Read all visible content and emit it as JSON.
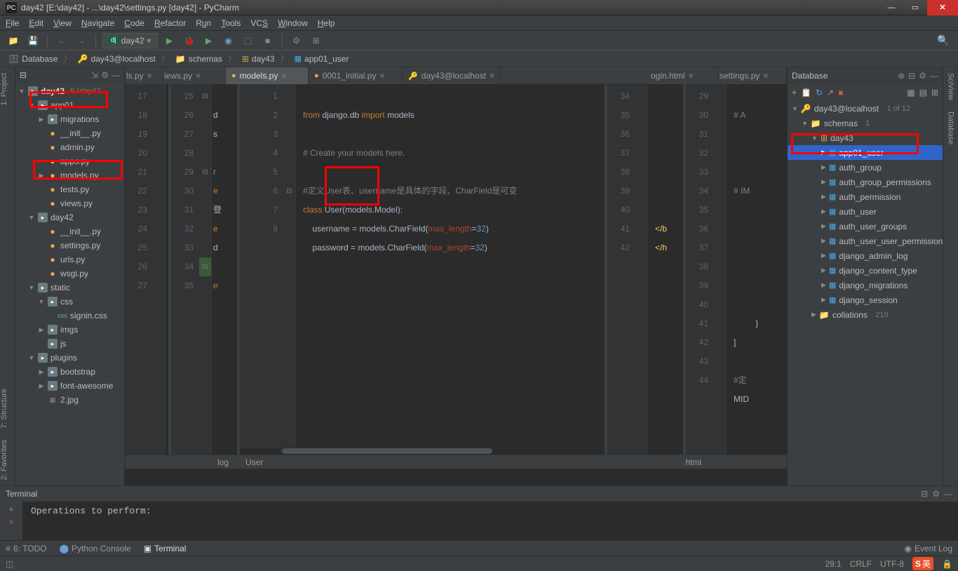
{
  "title": "day42 [E:\\day42] - ...\\day42\\settings.py [day42] - PyCharm",
  "menu": [
    "File",
    "Edit",
    "View",
    "Navigate",
    "Code",
    "Refactor",
    "Run",
    "Tools",
    "VCS",
    "Window",
    "Help"
  ],
  "run_config": "day42",
  "breadcrumb": {
    "db": "Database",
    "conn": "day43@localhost",
    "schemas": "schemas",
    "schema": "day43",
    "table": "app01_user"
  },
  "left_tabs": [
    "1: Project",
    "7: Structure",
    "2: Favorites"
  ],
  "right_tabs": [
    "SciView",
    "Database"
  ],
  "project": {
    "root": {
      "name": "day42",
      "path": "E:\\day42"
    },
    "app01": "app01",
    "migrations": "migrations",
    "files_app01": [
      "__init__.py",
      "admin.py",
      "apps.py",
      "models.py",
      "tests.py",
      "views.py"
    ],
    "day42_folder": "day42",
    "files_day42": [
      "__init__.py",
      "settings.py",
      "urls.py",
      "wsgi.py"
    ],
    "static": "static",
    "css": "css",
    "signin": "signin.css",
    "imgs": "imgs",
    "js": "js",
    "plugins": "plugins",
    "bootstrap": "bootstrap",
    "font": "font-awesome",
    "jpg": "2.jpg"
  },
  "tabs": {
    "t1": "ls.py",
    "t2": "iews.py",
    "t3": "models.py",
    "t4": "0001_initial.py",
    "t5": "day43@localhost",
    "t6": "ogin.html",
    "t7": "settings.py"
  },
  "col1": {
    "lines": [
      "17",
      "18",
      "19",
      "20",
      "21",
      "22",
      "23",
      "24",
      "25",
      "26",
      "27"
    ],
    "bc": "log"
  },
  "col2": {
    "lines": [
      "25",
      "26",
      "27",
      "28",
      "29",
      "30",
      "31",
      "32",
      "33",
      "34",
      "35"
    ],
    "chars": [
      "d",
      "s",
      "",
      "r",
      "e",
      "登",
      "e",
      "d",
      "",
      "e",
      ""
    ]
  },
  "col3": {
    "lines": [
      "1",
      "2",
      "3",
      "4",
      "5",
      "6",
      "7",
      "8"
    ],
    "l1_a": "from",
    "l1_b": " django.db ",
    "l1_c": "import",
    "l1_d": " models",
    "l3": "# Create your models here.",
    "l5": "#定义User表、username是具体的字段、CharField是可变",
    "l6_a": "class ",
    "l6_b": "User",
    "l6_c": "(models.Model):",
    "l7_a": "    username = models.CharField(",
    "l7_b": "max_length",
    "l7_c": "=",
    "l7_d": "32",
    "l7_e": ")",
    "l8_a": "    password = models.CharField(",
    "l8_b": "max_length",
    "l8_c": "=",
    "l8_d": "32",
    "l8_e": ")",
    "bc": "User"
  },
  "col4": {
    "lines": [
      "34",
      "35",
      "36",
      "37",
      "38",
      "39",
      "40",
      "41",
      "42"
    ],
    "c1": "</b",
    "c2": "</h",
    "bc": "html"
  },
  "col5": {
    "lines": [
      "29",
      "30",
      "31",
      "32",
      "33",
      "34",
      "35",
      "36",
      "37",
      "38",
      "39",
      "40",
      "41",
      "42",
      "43",
      "44"
    ],
    "c1": "# A",
    "c2": "# IM",
    "c3": "}",
    "c4": "]",
    "c5": "#定",
    "c6": "MID"
  },
  "database": {
    "title": "Database",
    "conn": "day43@localhost",
    "conn_cnt": "1 of 12",
    "schemas": "schemas",
    "schemas_cnt": "1",
    "schema": "day43",
    "tables": [
      "app01_user",
      "auth_group",
      "auth_group_permissions",
      "auth_permission",
      "auth_user",
      "auth_user_groups",
      "auth_user_user_permissions",
      "django_admin_log",
      "django_content_type",
      "django_migrations",
      "django_session"
    ],
    "collations": "collations",
    "coll_cnt": "219"
  },
  "terminal": {
    "title": "Terminal",
    "output": "Operations to perform:"
  },
  "bottom": {
    "todo": "6: TODO",
    "pyconsole": "Python Console",
    "terminal": "Terminal",
    "event": "Event Log"
  },
  "status": {
    "pos": "29:1",
    "crlf": "CRLF",
    "enc": "UTF-8",
    "ime": "英"
  }
}
